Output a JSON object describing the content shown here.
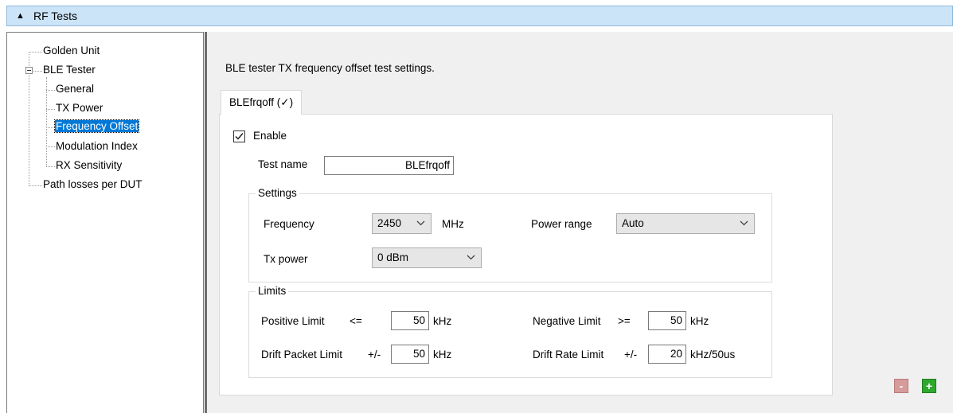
{
  "header": {
    "title": "RF Tests",
    "collapse_icon": "triangle-up-icon"
  },
  "tree": {
    "items": [
      {
        "label": "Golden Unit"
      },
      {
        "label": "BLE Tester"
      },
      {
        "label": "General"
      },
      {
        "label": "TX Power"
      },
      {
        "label": "Frequency Offset",
        "selected": true
      },
      {
        "label": "Modulation Index"
      },
      {
        "label": "RX Sensitivity"
      },
      {
        "label": "Path losses per DUT"
      }
    ]
  },
  "main": {
    "description": "BLE tester TX frequency offset test settings.",
    "tab_label": "BLEfrqoff (✓)",
    "enable_label": "Enable",
    "enable_checked": true,
    "test_name_label": "Test name",
    "test_name_value": "BLEfrqoff",
    "settings": {
      "title": "Settings",
      "frequency_label": "Frequency",
      "frequency_value": "2450",
      "frequency_unit": "MHz",
      "power_range_label": "Power range",
      "power_range_value": "Auto",
      "tx_power_label": "Tx power",
      "tx_power_value": "0 dBm"
    },
    "limits": {
      "title": "Limits",
      "positive_label": "Positive Limit",
      "positive_op": "<=",
      "positive_value": "50",
      "positive_unit": "kHz",
      "negative_label": "Negative Limit",
      "negative_op": ">=",
      "negative_value": "50",
      "negative_unit": "kHz",
      "drift_packet_label": "Drift Packet Limit",
      "drift_packet_op": "+/-",
      "drift_packet_value": "50",
      "drift_packet_unit": "kHz",
      "drift_rate_label": "Drift Rate Limit",
      "drift_rate_op": "+/-",
      "drift_rate_value": "20",
      "drift_rate_unit": "kHz/50us"
    },
    "buttons": {
      "remove": "-",
      "add": "+"
    }
  },
  "colors": {
    "header_bg": "#cce4f7",
    "selection": "#0078d7",
    "add_button": "#2ea82e",
    "remove_button": "#d79a9a"
  }
}
